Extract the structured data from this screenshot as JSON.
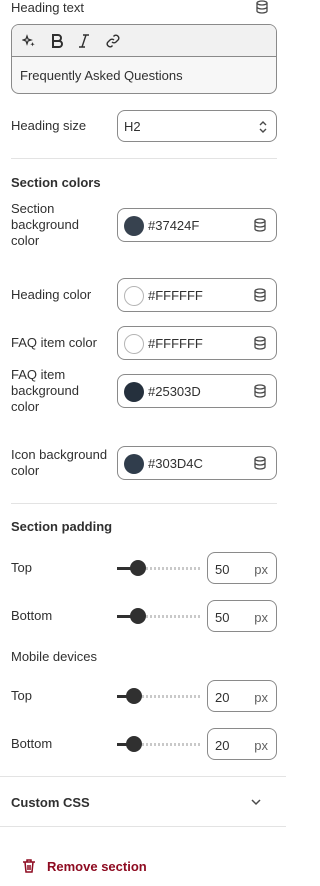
{
  "heading_text": {
    "label": "Heading text",
    "toolbar": [
      "sparkle-icon",
      "bold-icon",
      "italic-icon",
      "link-icon"
    ],
    "value": "Frequently Asked Questions"
  },
  "heading_size": {
    "label": "Heading size",
    "value": "H2"
  },
  "section_colors": {
    "title": "Section colors",
    "items": [
      {
        "label": [
          "Section",
          "background",
          "color"
        ],
        "hex": "#37424F",
        "swatch": "#37424F"
      },
      {
        "label": [
          "Heading color"
        ],
        "hex": "#FFFFFF",
        "swatch": "#FFFFFF"
      },
      {
        "label": [
          "FAQ item color"
        ],
        "hex": "#FFFFFF",
        "swatch": "#FFFFFF"
      },
      {
        "label": [
          "FAQ item",
          "background",
          "color"
        ],
        "hex": "#25303D",
        "swatch": "#25303D"
      },
      {
        "label": [
          "Icon background",
          "color"
        ],
        "hex": "#303D4C",
        "swatch": "#303D4C"
      }
    ]
  },
  "section_padding": {
    "title": "Section padding",
    "top": {
      "label": "Top",
      "value": "50",
      "unit": "px",
      "fraction": 0.25
    },
    "bottom": {
      "label": "Bottom",
      "value": "50",
      "unit": "px",
      "fraction": 0.25
    },
    "mobile_title": "Mobile devices",
    "mobile_top": {
      "label": "Top",
      "value": "20",
      "unit": "px",
      "fraction": 0.2
    },
    "mobile_bottom": {
      "label": "Bottom",
      "value": "20",
      "unit": "px",
      "fraction": 0.2
    }
  },
  "custom_css": {
    "title": "Custom CSS"
  },
  "remove_section": {
    "label": "Remove section"
  }
}
